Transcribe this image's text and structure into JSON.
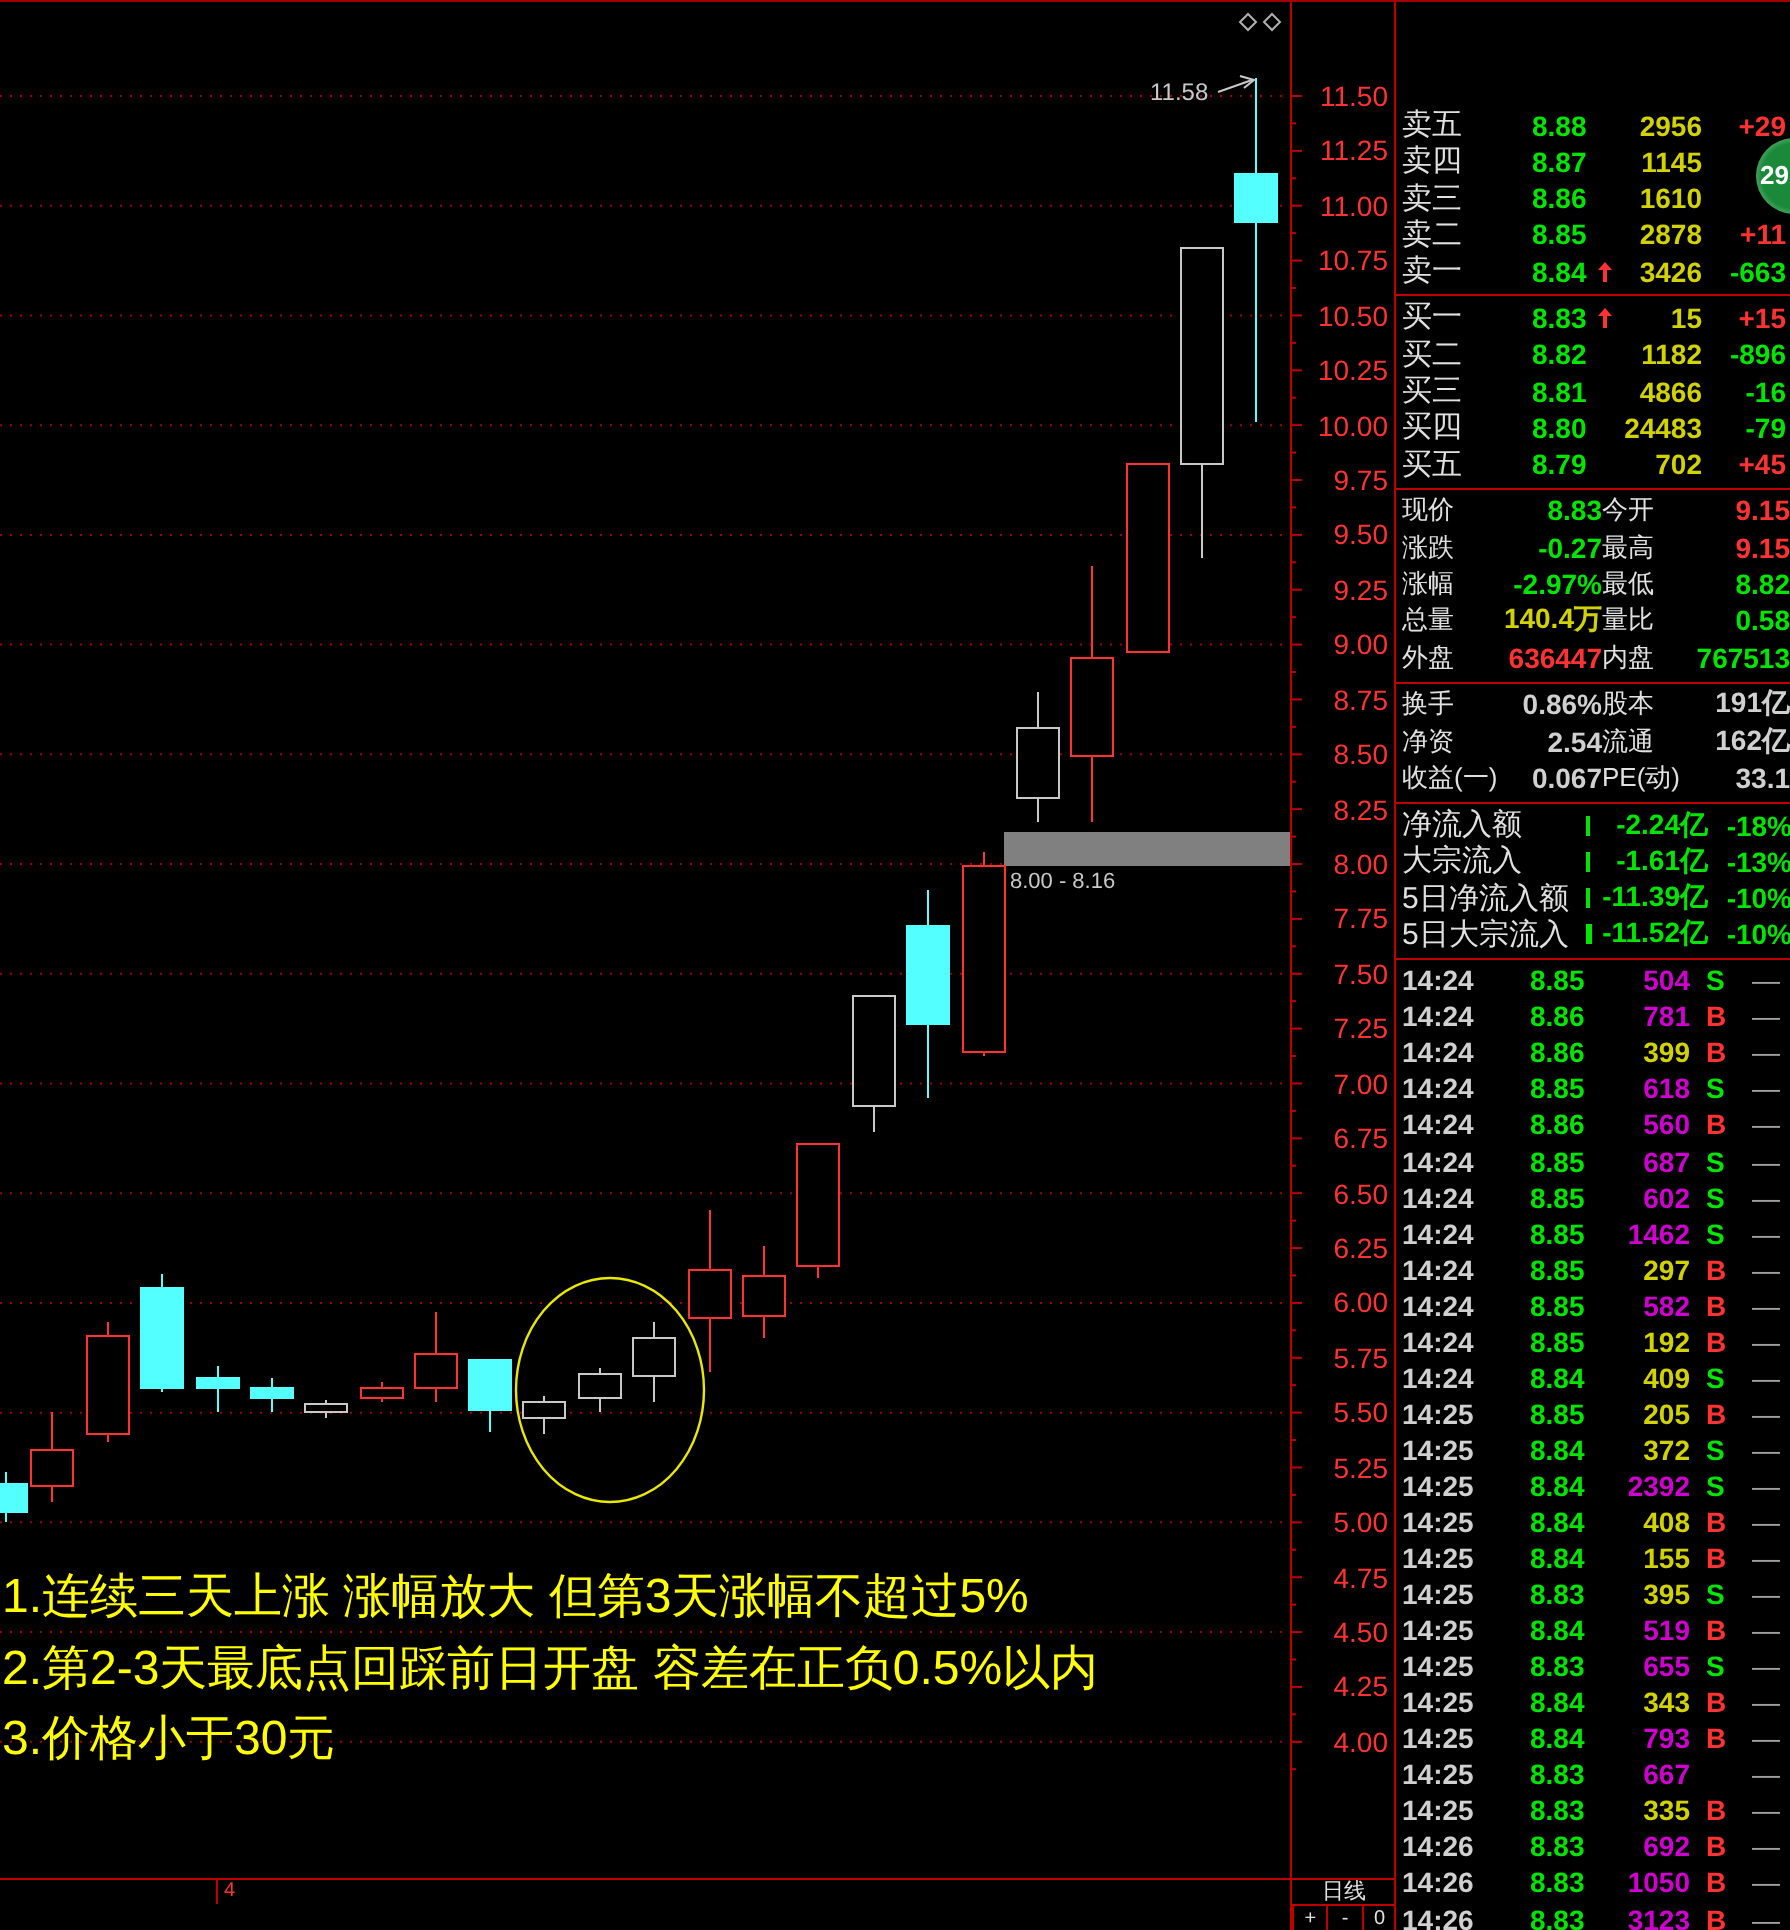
{
  "chart": {
    "axis_labels": [
      "11.50",
      "11.25",
      "11.00",
      "10.75",
      "10.50",
      "10.25",
      "10.00",
      "9.75",
      "9.50",
      "9.25",
      "9.00",
      "8.75",
      "8.50",
      "8.25",
      "8.00",
      "7.75",
      "7.50",
      "7.25",
      "7.00",
      "6.75",
      "6.50",
      "6.25",
      "6.00",
      "5.75",
      "5.50",
      "5.25",
      "5.00",
      "4.75",
      "4.50",
      "4.25",
      "4.00"
    ],
    "high_label": "11.58",
    "band_label": "8.00 - 8.16",
    "notes": [
      "1.连续三天上涨 涨幅放大 但第3天涨幅不超过5%",
      "2.第2-3天最底点回踩前日开盘 容差在正负0.5%以内",
      "3.价格小于30元"
    ],
    "bottom_marker": "4",
    "period": "日线",
    "zoom_buttons": [
      "+",
      "-",
      "0"
    ]
  },
  "badge": "29",
  "order_book": {
    "asks": [
      {
        "label": "卖五",
        "price": "8.88",
        "arrow": false,
        "volume": "2956",
        "change": "+29",
        "up": true
      },
      {
        "label": "卖四",
        "price": "8.87",
        "arrow": false,
        "volume": "1145"
      },
      {
        "label": "卖三",
        "price": "8.86",
        "arrow": false,
        "volume": "1610"
      },
      {
        "label": "卖二",
        "price": "8.85",
        "arrow": false,
        "volume": "2878",
        "change": "+11",
        "up": true
      },
      {
        "label": "卖一",
        "price": "8.84",
        "arrow": true,
        "volume": "3426",
        "change": "-663",
        "up": false
      }
    ],
    "bids": [
      {
        "label": "买一",
        "price": "8.83",
        "arrow": true,
        "volume": "15",
        "change": "+15",
        "up": true
      },
      {
        "label": "买二",
        "price": "8.82",
        "arrow": false,
        "volume": "1182",
        "change": "-896",
        "up": false
      },
      {
        "label": "买三",
        "price": "8.81",
        "arrow": false,
        "volume": "4866",
        "change": "-16",
        "up": false
      },
      {
        "label": "买四",
        "price": "8.80",
        "arrow": false,
        "volume": "24483",
        "change": "-79",
        "up": false
      },
      {
        "label": "买五",
        "price": "8.79",
        "arrow": false,
        "volume": "702",
        "change": "+45",
        "up": true
      }
    ]
  },
  "quote": [
    {
      "label": "现价",
      "value": "8.83",
      "color": "#00e600"
    },
    {
      "label": "今开",
      "value": "9.15",
      "color": "#ff3232"
    },
    {
      "label": "涨跌",
      "value": "-0.27",
      "color": "#00e600"
    },
    {
      "label": "最高",
      "value": "9.15",
      "color": "#ff3232"
    },
    {
      "label": "涨幅",
      "value": "-2.97%",
      "color": "#00e600"
    },
    {
      "label": "最低",
      "value": "8.82",
      "color": "#00e600"
    },
    {
      "label": "总量",
      "value": "140.4万",
      "color": "#d2d200"
    },
    {
      "label": "量比",
      "value": "0.58",
      "color": "#00e600"
    },
    {
      "label": "外盘",
      "value": "636447",
      "color": "#ff3232"
    },
    {
      "label": "内盘",
      "value": "767513",
      "color": "#00e600"
    }
  ],
  "fundamentals": [
    {
      "label": "换手",
      "value": "0.86%"
    },
    {
      "label": "股本",
      "value": "191亿"
    },
    {
      "label": "净资",
      "value": "2.54"
    },
    {
      "label": "流通",
      "value": "162亿"
    },
    {
      "label": "收益(一)",
      "value": "0.067"
    },
    {
      "label": "PE(动)",
      "value": "33.1"
    }
  ],
  "flows": [
    {
      "label": "净流入额",
      "value": "-2.24亿",
      "percent": "-18%"
    },
    {
      "label": "大宗流入",
      "value": "-1.61亿",
      "percent": "-13%"
    },
    {
      "label": "5日净流入额",
      "value": "-11.39亿",
      "percent": "-10%"
    },
    {
      "label": "5日大宗流入",
      "value": "-11.52亿",
      "percent": "-10%"
    }
  ],
  "trades": [
    {
      "time": "14:24",
      "price": "8.85",
      "volume": "504",
      "big": true,
      "buy": false,
      "flag": "S",
      "tick": "—"
    },
    {
      "time": "14:24",
      "price": "8.86",
      "volume": "781",
      "big": true,
      "buy": true,
      "flag": "B",
      "tick": "—"
    },
    {
      "time": "14:24",
      "price": "8.86",
      "volume": "399",
      "big": false,
      "buy": true,
      "flag": "B",
      "tick": "—"
    },
    {
      "time": "14:24",
      "price": "8.85",
      "volume": "618",
      "big": true,
      "buy": false,
      "flag": "S",
      "tick": "—"
    },
    {
      "time": "14:24",
      "price": "8.86",
      "volume": "560",
      "big": true,
      "buy": true,
      "flag": "B",
      "tick": "—"
    },
    {
      "time": "14:24",
      "price": "8.85",
      "volume": "687",
      "big": true,
      "buy": false,
      "flag": "S",
      "tick": "—"
    },
    {
      "time": "14:24",
      "price": "8.85",
      "volume": "602",
      "big": true,
      "buy": false,
      "flag": "S",
      "tick": "—"
    },
    {
      "time": "14:24",
      "price": "8.85",
      "volume": "1462",
      "big": true,
      "buy": false,
      "flag": "S",
      "tick": "—"
    },
    {
      "time": "14:24",
      "price": "8.85",
      "volume": "297",
      "big": false,
      "buy": true,
      "flag": "B",
      "tick": "—"
    },
    {
      "time": "14:24",
      "price": "8.85",
      "volume": "582",
      "big": true,
      "buy": true,
      "flag": "B",
      "tick": "—"
    },
    {
      "time": "14:24",
      "price": "8.85",
      "volume": "192",
      "big": false,
      "buy": true,
      "flag": "B",
      "tick": "—"
    },
    {
      "time": "14:24",
      "price": "8.84",
      "volume": "409",
      "big": false,
      "buy": false,
      "flag": "S",
      "tick": "—"
    },
    {
      "time": "14:25",
      "price": "8.85",
      "volume": "205",
      "big": false,
      "buy": true,
      "flag": "B",
      "tick": "—"
    },
    {
      "time": "14:25",
      "price": "8.84",
      "volume": "372",
      "big": false,
      "buy": false,
      "flag": "S",
      "tick": "—"
    },
    {
      "time": "14:25",
      "price": "8.84",
      "volume": "2392",
      "big": true,
      "buy": false,
      "flag": "S",
      "tick": "—"
    },
    {
      "time": "14:25",
      "price": "8.84",
      "volume": "408",
      "big": false,
      "buy": true,
      "flag": "B",
      "tick": "—"
    },
    {
      "time": "14:25",
      "price": "8.84",
      "volume": "155",
      "big": false,
      "buy": true,
      "flag": "B",
      "tick": "—"
    },
    {
      "time": "14:25",
      "price": "8.83",
      "volume": "395",
      "big": false,
      "buy": false,
      "flag": "S",
      "tick": "—"
    },
    {
      "time": "14:25",
      "price": "8.84",
      "volume": "519",
      "big": true,
      "buy": true,
      "flag": "B",
      "tick": "—"
    },
    {
      "time": "14:25",
      "price": "8.83",
      "volume": "655",
      "big": true,
      "buy": false,
      "flag": "S",
      "tick": "—"
    },
    {
      "time": "14:25",
      "price": "8.84",
      "volume": "343",
      "big": false,
      "buy": true,
      "flag": "B",
      "tick": "—"
    },
    {
      "time": "14:25",
      "price": "8.84",
      "volume": "793",
      "big": true,
      "buy": true,
      "flag": "B",
      "tick": "—"
    },
    {
      "time": "14:25",
      "price": "8.83",
      "volume": "667",
      "big": true,
      "tick": "—"
    },
    {
      "time": "14:25",
      "price": "8.83",
      "volume": "335",
      "big": false,
      "buy": true,
      "flag": "B",
      "tick": "—"
    },
    {
      "time": "14:26",
      "price": "8.83",
      "volume": "692",
      "big": true,
      "buy": true,
      "flag": "B",
      "tick": "—"
    },
    {
      "time": "14:26",
      "price": "8.83",
      "volume": "1050",
      "big": true,
      "buy": true,
      "flag": "B",
      "tick": "—"
    },
    {
      "time": "14:26",
      "price": "8.83",
      "volume": "3123",
      "big": true,
      "buy": true,
      "flag": "B",
      "tick": "—"
    }
  ]
}
